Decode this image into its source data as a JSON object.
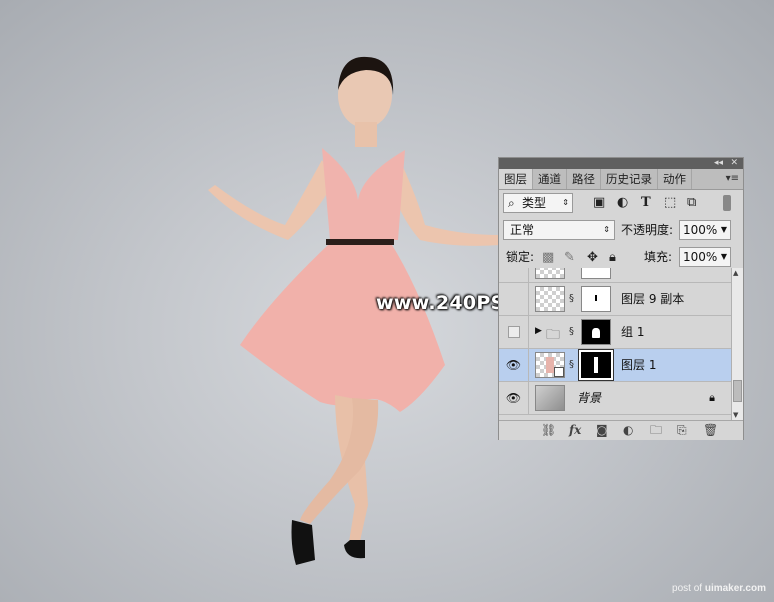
{
  "watermark": {
    "site": "www.240PS.com",
    "credit_prefix": "post of ",
    "credit_brand": "uimaker.com"
  },
  "panel": {
    "tabs": [
      "图层",
      "通道",
      "路径",
      "历史记录",
      "动作"
    ],
    "active_tab": "图层",
    "filter": {
      "value": "类型",
      "icons": [
        "image-filter-icon",
        "adjustment-filter-icon",
        "text-filter-icon",
        "shape-filter-icon",
        "smart-object-filter-icon"
      ]
    },
    "blend_mode": "正常",
    "opacity_label": "不透明度:",
    "opacity_value": "100%",
    "lock_label": "锁定:",
    "fill_label": "填充:",
    "fill_value": "100%",
    "layers": [
      {
        "name": "图层 9 副本",
        "visible": false,
        "selected": false,
        "type": "layer-with-mask"
      },
      {
        "name": "组 1",
        "visible": false,
        "selected": false,
        "type": "group"
      },
      {
        "name": "图层 1",
        "visible": true,
        "selected": true,
        "type": "smart-layer-with-mask"
      },
      {
        "name": "背景",
        "visible": true,
        "selected": false,
        "type": "background",
        "locked": true
      }
    ],
    "footer_icons": [
      "link-icon",
      "fx-icon",
      "add-mask-icon",
      "adjustment-icon",
      "new-group-icon",
      "new-layer-icon",
      "delete-icon"
    ],
    "footer_fx_label": "fx"
  },
  "colors": {
    "selection": "#b9cfee",
    "panel_bg": "#d6d6d6",
    "dress": "#f0b3ad"
  }
}
